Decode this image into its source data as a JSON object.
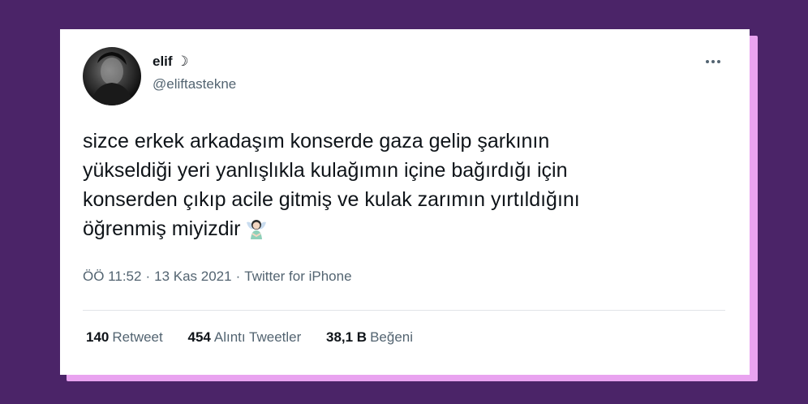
{
  "tweet": {
    "display_name": "elif ☽",
    "handle": "@eliftastekne",
    "text_lines": [
      "sizce erkek arkadaşım konserde gaza gelip şarkının",
      "yükseldiği yeri yanlışlıkla kulağımın içine bağırdığı için",
      "konserden çıkıp acile gitmiş ve kulak zarımın yırtıldığını",
      "öğrenmiş miyizdir"
    ],
    "emoji": "fairy-emoji",
    "time": "ÖÖ 11:52",
    "date": "13 Kas 2021",
    "source": "Twitter for iPhone",
    "separator": "·",
    "stats": {
      "retweets_count": "140",
      "retweets_label": "Retweet",
      "quotes_count": "454",
      "quotes_label": "Alıntı Tweetler",
      "likes_count": "38,1 B",
      "likes_label": "Beğeni"
    }
  },
  "colors": {
    "background": "#4b2468",
    "card_shadow": "#e9a3f0",
    "text_primary": "#0f1419",
    "text_secondary": "#536471"
  }
}
